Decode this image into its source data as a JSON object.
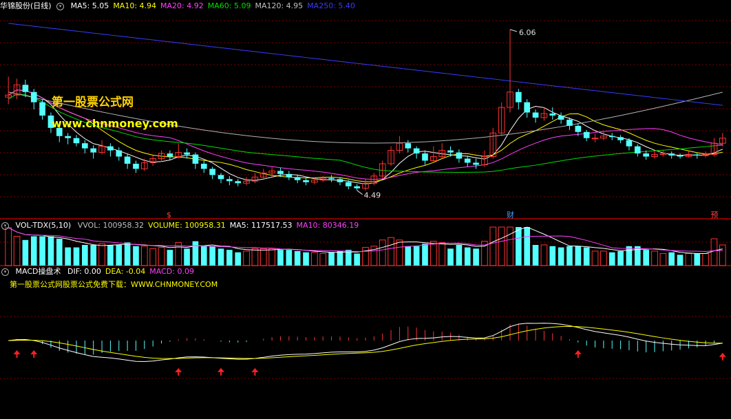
{
  "price_panel": {
    "stock_name": "华锦股份(日线)",
    "ma_labels": [
      {
        "label": "MA5: 5.05",
        "color": "#ffffff"
      },
      {
        "label": "MA10: 4.94",
        "color": "#ffff00"
      },
      {
        "label": "MA20: 4.92",
        "color": "#ff40ff"
      },
      {
        "label": "MA60: 5.09",
        "color": "#00e000"
      },
      {
        "label": "MA120: 4.95",
        "color": "#c0c0c0"
      },
      {
        "label": "MA250: 5.40",
        "color": "#3a3aff"
      }
    ],
    "high_label": "6.06",
    "low_label": "4.49",
    "markers": [
      {
        "text": "$",
        "color": "#ff4040"
      },
      {
        "text": "财",
        "color": "#40a0ff"
      },
      {
        "text": "预",
        "color": "#ff4040"
      }
    ]
  },
  "volume_panel": {
    "title": "VOL-TDX(5,10)",
    "labels": [
      {
        "label": "VVOL: 100958.32",
        "color": "#c0c0c0"
      },
      {
        "label": "VOLUME: 100958.31",
        "color": "#ffff00"
      },
      {
        "label": "MA5: 117517.53",
        "color": "#ffffff"
      },
      {
        "label": "MA10: 80346.19",
        "color": "#ff40ff"
      }
    ]
  },
  "macd_panel": {
    "title": "MACD操盘术",
    "labels": [
      {
        "label": "DIF: 0.00",
        "color": "#ffffff"
      },
      {
        "label": "DEA: -0.04",
        "color": "#ffff00"
      },
      {
        "label": "MACD: 0.09",
        "color": "#ff40ff"
      }
    ],
    "promo": "第一股票公式网股票公式免费下载：WWW.CHNMONEY.COM"
  },
  "watermark": {
    "line1": "第一股票公式网",
    "line2": "www.chnmoney.com"
  },
  "colors": {
    "up": "#ff3232",
    "down": "#54ffff",
    "grid": "#7a0000",
    "separator": "#b00000"
  },
  "chart_data": {
    "type": "candlestick",
    "title": "华锦股份(日线)",
    "price_range": [
      4.3,
      6.2
    ],
    "candles": [
      [
        5.4,
        5.42,
        5.6,
        5.33
      ],
      [
        5.42,
        5.52,
        5.58,
        5.38
      ],
      [
        5.52,
        5.45,
        5.57,
        5.4
      ],
      [
        5.45,
        5.35,
        5.48,
        5.28
      ],
      [
        5.35,
        5.22,
        5.38,
        5.18
      ],
      [
        5.22,
        5.1,
        5.25,
        5.05
      ],
      [
        5.1,
        5.02,
        5.14,
        4.96
      ],
      [
        5.02,
        5.0,
        5.05,
        4.94
      ],
      [
        5.0,
        4.95,
        5.03,
        4.92
      ],
      [
        4.95,
        4.9,
        4.98,
        4.85
      ],
      [
        4.9,
        4.86,
        4.93,
        4.8
      ],
      [
        4.86,
        4.92,
        4.98,
        4.84
      ],
      [
        4.92,
        4.88,
        4.95,
        4.82
      ],
      [
        4.88,
        4.82,
        4.91,
        4.78
      ],
      [
        4.82,
        4.75,
        4.85,
        4.7
      ],
      [
        4.75,
        4.7,
        4.78,
        4.66
      ],
      [
        4.7,
        4.76,
        4.8,
        4.68
      ],
      [
        4.76,
        4.8,
        4.83,
        4.73
      ],
      [
        4.8,
        4.85,
        4.88,
        4.77
      ],
      [
        4.85,
        4.82,
        4.88,
        4.79
      ],
      [
        4.82,
        4.86,
        4.95,
        4.8
      ],
      [
        4.86,
        4.84,
        4.9,
        4.8
      ],
      [
        4.84,
        4.75,
        4.86,
        4.7
      ],
      [
        4.75,
        4.7,
        4.78,
        4.66
      ],
      [
        4.7,
        4.64,
        4.72,
        4.6
      ],
      [
        4.64,
        4.6,
        4.66,
        4.56
      ],
      [
        4.6,
        4.58,
        4.63,
        4.54
      ],
      [
        4.58,
        4.56,
        4.6,
        4.53
      ],
      [
        4.56,
        4.58,
        4.62,
        4.54
      ],
      [
        4.58,
        4.62,
        4.66,
        4.56
      ],
      [
        4.62,
        4.66,
        4.7,
        4.6
      ],
      [
        4.66,
        4.68,
        4.72,
        4.62
      ],
      [
        4.68,
        4.65,
        4.71,
        4.62
      ],
      [
        4.65,
        4.62,
        4.68,
        4.59
      ],
      [
        4.62,
        4.59,
        4.64,
        4.56
      ],
      [
        4.59,
        4.57,
        4.61,
        4.54
      ],
      [
        4.57,
        4.59,
        4.62,
        4.55
      ],
      [
        4.59,
        4.61,
        4.63,
        4.57
      ],
      [
        4.61,
        4.6,
        4.64,
        4.57
      ],
      [
        4.6,
        4.57,
        4.62,
        4.54
      ],
      [
        4.57,
        4.53,
        4.59,
        4.5
      ],
      [
        4.53,
        4.51,
        4.55,
        4.49
      ],
      [
        4.51,
        4.56,
        4.6,
        4.49
      ],
      [
        4.56,
        4.63,
        4.66,
        4.54
      ],
      [
        4.63,
        4.75,
        4.78,
        4.61
      ],
      [
        4.75,
        4.88,
        4.92,
        4.73
      ],
      [
        4.88,
        4.95,
        5.02,
        4.85
      ],
      [
        4.95,
        4.9,
        4.98,
        4.86
      ],
      [
        4.9,
        4.85,
        4.92,
        4.8
      ],
      [
        4.85,
        4.78,
        4.88,
        4.74
      ],
      [
        4.78,
        4.82,
        4.92,
        4.76
      ],
      [
        4.82,
        4.88,
        4.95,
        4.8
      ],
      [
        4.88,
        4.86,
        4.92,
        4.82
      ],
      [
        4.86,
        4.8,
        4.89,
        4.76
      ],
      [
        4.8,
        4.76,
        4.83,
        4.72
      ],
      [
        4.76,
        4.74,
        4.8,
        4.7
      ],
      [
        4.74,
        4.82,
        4.88,
        4.72
      ],
      [
        4.82,
        5.05,
        5.1,
        4.8
      ],
      [
        5.05,
        5.3,
        5.35,
        5.02
      ],
      [
        5.3,
        5.45,
        6.06,
        5.25
      ],
      [
        5.45,
        5.35,
        5.48,
        5.28
      ],
      [
        5.35,
        5.25,
        5.38,
        5.2
      ],
      [
        5.25,
        5.2,
        5.28,
        5.15
      ],
      [
        5.2,
        5.24,
        5.3,
        5.17
      ],
      [
        5.24,
        5.22,
        5.3,
        5.18
      ],
      [
        5.22,
        5.18,
        5.25,
        5.14
      ],
      [
        5.18,
        5.12,
        5.2,
        5.08
      ],
      [
        5.12,
        5.06,
        5.14,
        5.02
      ],
      [
        5.06,
        5.0,
        5.08,
        4.97
      ],
      [
        5.0,
        5.0,
        5.04,
        4.96
      ],
      [
        5.0,
        5.02,
        5.06,
        4.98
      ],
      [
        5.02,
        5.01,
        5.05,
        4.98
      ],
      [
        5.01,
        4.98,
        5.03,
        4.95
      ],
      [
        4.98,
        4.92,
        5.0,
        4.88
      ],
      [
        4.92,
        4.85,
        4.94,
        4.82
      ],
      [
        4.85,
        4.82,
        4.88,
        4.79
      ],
      [
        4.82,
        4.84,
        4.88,
        4.8
      ],
      [
        4.84,
        4.85,
        4.88,
        4.82
      ],
      [
        4.85,
        4.83,
        4.87,
        4.8
      ],
      [
        4.83,
        4.82,
        4.85,
        4.8
      ],
      [
        4.82,
        4.84,
        4.87,
        4.81
      ],
      [
        4.84,
        4.83,
        4.86,
        4.8
      ],
      [
        4.83,
        4.84,
        4.87,
        4.81
      ],
      [
        4.84,
        4.95,
        5.0,
        4.82
      ],
      [
        4.95,
        5.0,
        5.05,
        4.92
      ]
    ],
    "macd_scale": [
      -0.45,
      0.42
    ]
  }
}
